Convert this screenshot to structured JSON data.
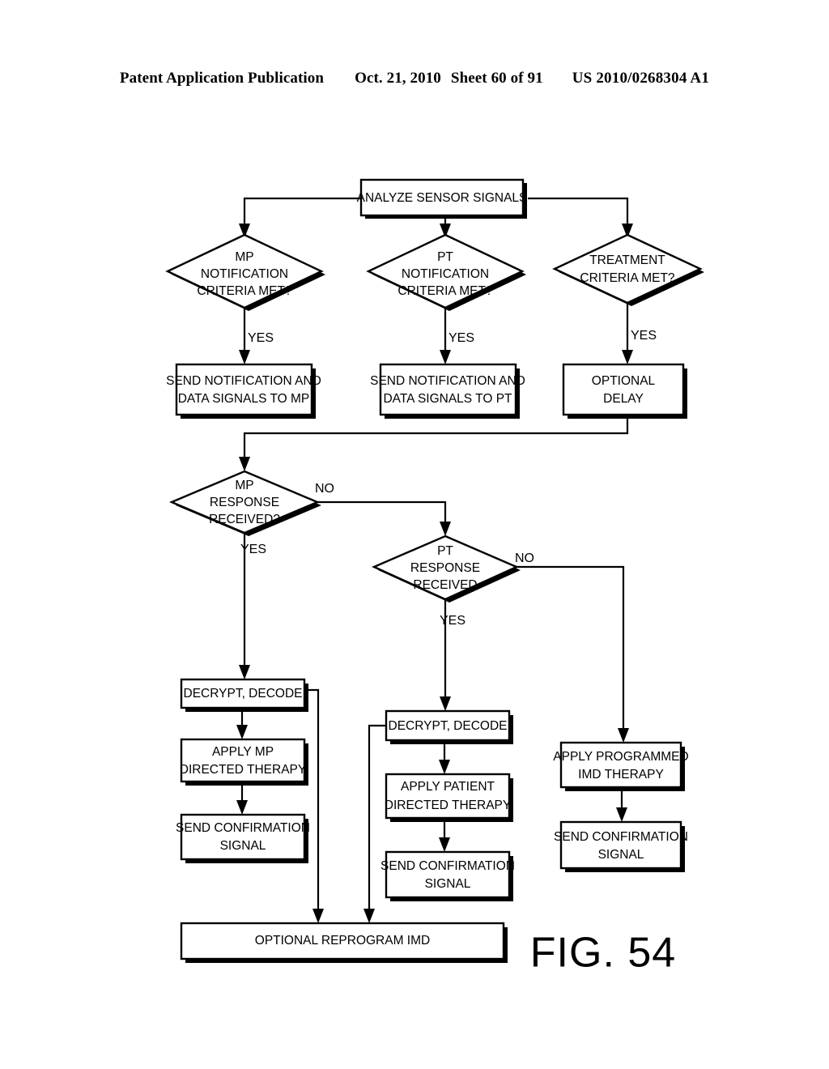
{
  "header": {
    "publication": "Patent Application Publication",
    "date": "Oct. 21, 2010",
    "sheet": "Sheet 60 of 91",
    "number": "US 2010/0268304 A1"
  },
  "figure": {
    "label": "FIG. 54"
  },
  "colors": {
    "ink": "#000000",
    "paper": "#ffffff"
  },
  "flowchart": {
    "title": "FIG. 54",
    "nodes": {
      "analyze_sensor_signals": {
        "type": "process",
        "lines": [
          "ANALYZE SENSOR SIGNALS"
        ]
      },
      "mp_notification_criteria": {
        "type": "decision",
        "lines": [
          "MP",
          "NOTIFICATION",
          "CRITERIA MET?"
        ]
      },
      "pt_notification_criteria": {
        "type": "decision",
        "lines": [
          "PT",
          "NOTIFICATION",
          "CRITERIA MET?"
        ]
      },
      "treatment_criteria": {
        "type": "decision",
        "lines": [
          "TREATMENT",
          "CRITERIA MET?"
        ]
      },
      "send_notification_mp": {
        "type": "process",
        "lines": [
          "SEND NOTIFICATION AND",
          "DATA SIGNALS TO MP"
        ]
      },
      "send_notification_pt": {
        "type": "process",
        "lines": [
          "SEND NOTIFICATION AND",
          "DATA SIGNALS TO PT"
        ]
      },
      "optional_delay": {
        "type": "process",
        "lines": [
          "OPTIONAL",
          "DELAY"
        ]
      },
      "mp_response_received": {
        "type": "decision",
        "lines": [
          "MP",
          "RESPONSE",
          "RECEIVED?"
        ]
      },
      "pt_response_received": {
        "type": "decision",
        "lines": [
          "PT",
          "RESPONSE",
          "RECEIVED"
        ]
      },
      "decrypt_decode_mp": {
        "type": "process",
        "lines": [
          "DECRYPT, DECODE"
        ]
      },
      "apply_mp_directed_therapy": {
        "type": "process",
        "lines": [
          "APPLY MP",
          "DIRECTED THERAPY"
        ]
      },
      "send_confirmation_mp": {
        "type": "process",
        "lines": [
          "SEND CONFIRMATION",
          "SIGNAL"
        ]
      },
      "decrypt_decode_pt": {
        "type": "process",
        "lines": [
          "DECRYPT, DECODE"
        ]
      },
      "apply_patient_directed_therapy": {
        "type": "process",
        "lines": [
          "APPLY PATIENT",
          "DIRECTED THERAPY"
        ]
      },
      "send_confirmation_pt": {
        "type": "process",
        "lines": [
          "SEND CONFIRMATION",
          "SIGNAL"
        ]
      },
      "apply_programmed_imd_therapy": {
        "type": "process",
        "lines": [
          "APPLY PROGRAMMED",
          "IMD THERAPY"
        ]
      },
      "send_confirmation_imd": {
        "type": "process",
        "lines": [
          "SEND CONFIRMATION",
          "SIGNAL"
        ]
      },
      "optional_reprogram_imd": {
        "type": "process",
        "lines": [
          "OPTIONAL REPROGRAM IMD"
        ]
      }
    },
    "edge_labels": {
      "mp_notification_yes": "YES",
      "pt_notification_yes": "YES",
      "treatment_yes": "YES",
      "mp_response_no": "NO",
      "mp_response_yes": "YES",
      "pt_response_no": "NO",
      "pt_response_yes": "YES"
    },
    "edges": [
      {
        "from": "analyze_sensor_signals",
        "to": "mp_notification_criteria",
        "label": ""
      },
      {
        "from": "analyze_sensor_signals",
        "to": "pt_notification_criteria",
        "label": ""
      },
      {
        "from": "analyze_sensor_signals",
        "to": "treatment_criteria",
        "label": ""
      },
      {
        "from": "mp_notification_criteria",
        "to": "send_notification_mp",
        "label": "YES"
      },
      {
        "from": "pt_notification_criteria",
        "to": "send_notification_pt",
        "label": "YES"
      },
      {
        "from": "treatment_criteria",
        "to": "optional_delay",
        "label": "YES"
      },
      {
        "from": "optional_delay",
        "to": "mp_response_received",
        "label": ""
      },
      {
        "from": "mp_response_received",
        "to": "pt_response_received",
        "label": "NO"
      },
      {
        "from": "mp_response_received",
        "to": "decrypt_decode_mp",
        "label": "YES"
      },
      {
        "from": "pt_response_received",
        "to": "apply_programmed_imd_therapy",
        "label": "NO"
      },
      {
        "from": "pt_response_received",
        "to": "decrypt_decode_pt",
        "label": "YES"
      },
      {
        "from": "decrypt_decode_mp",
        "to": "apply_mp_directed_therapy",
        "label": ""
      },
      {
        "from": "apply_mp_directed_therapy",
        "to": "send_confirmation_mp",
        "label": ""
      },
      {
        "from": "decrypt_decode_pt",
        "to": "apply_patient_directed_therapy",
        "label": ""
      },
      {
        "from": "apply_patient_directed_therapy",
        "to": "send_confirmation_pt",
        "label": ""
      },
      {
        "from": "apply_programmed_imd_therapy",
        "to": "send_confirmation_imd",
        "label": ""
      },
      {
        "from": "decrypt_decode_mp",
        "to": "optional_reprogram_imd",
        "label": ""
      },
      {
        "from": "decrypt_decode_pt",
        "to": "optional_reprogram_imd",
        "label": ""
      }
    ]
  }
}
